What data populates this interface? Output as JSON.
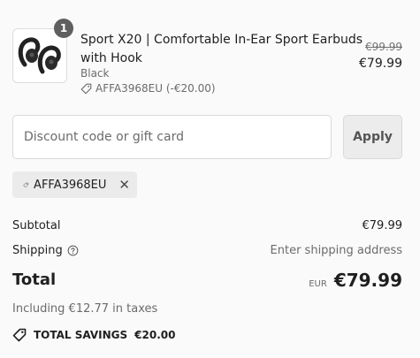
{
  "product": {
    "quantity": "1",
    "title": "Sport X20 | Comfortable In-Ear Sport Earbuds with Hook",
    "variant": "Black",
    "discount_line": "AFFA3968EU (-€20.00)",
    "original_price": "€99.99",
    "price": "€79.99",
    "image_icon": "earbuds-image"
  },
  "discount": {
    "placeholder": "Discount code or gift card",
    "value": "",
    "apply_label": "Apply",
    "applied_code": "AFFA3968EU",
    "remove_icon": "close-icon"
  },
  "summary": {
    "subtotal_label": "Subtotal",
    "subtotal_value": "€79.99",
    "shipping_label": "Shipping",
    "shipping_value": "Enter shipping address",
    "total_label": "Total",
    "currency": "EUR",
    "total_value": "€79.99",
    "taxes_text": "Including €12.77 in taxes",
    "savings_label": "TOTAL SAVINGS",
    "savings_value": "€20.00"
  }
}
